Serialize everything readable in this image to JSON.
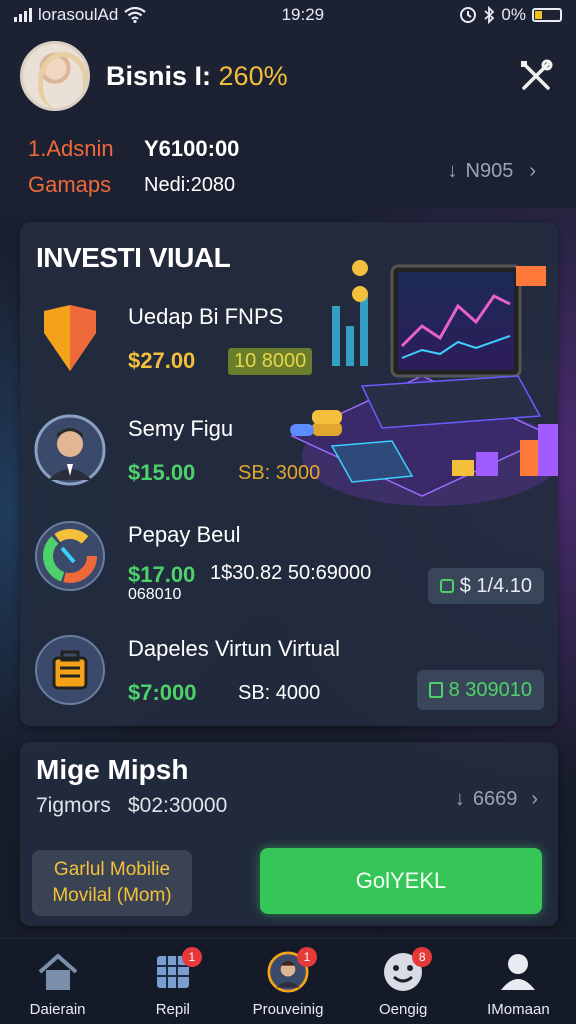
{
  "status_bar": {
    "carrier": "lorasoulAd",
    "time": "19:29",
    "battery": "0%"
  },
  "header": {
    "title": "Bisnis I: ",
    "percent": "260%"
  },
  "summary": {
    "row1_label": "1.Adsnin",
    "row1_value": "Y6100:00",
    "row2_label": "Gamaps",
    "row2_value": "Nedi:2080",
    "right_value": "N905"
  },
  "invest_card": {
    "title": "INVESTI VIUAL",
    "items": [
      {
        "name": "Uedap Bi FNPS",
        "price": "$27.00",
        "meta": "10 8000",
        "meta_color": "#e8d64a"
      },
      {
        "name": "Semy Figu",
        "price": "$15.00",
        "meta": "SB: 3000",
        "meta_color": "#e0a62e"
      },
      {
        "name": "Pepay Beul",
        "price": "$17.00",
        "meta": "1$30.82 50:69000",
        "meta2": "068010",
        "pill": "$ 1/4.10",
        "meta_color": "#e8ecf2"
      },
      {
        "name": "Dapeles Virtun Virtual",
        "price": "$7:000",
        "meta": "SB: 4000",
        "pill": "8 309010",
        "meta_color": "#e8ecf2"
      }
    ]
  },
  "bottom_card": {
    "title": "Mige Mipsh",
    "sub_label": "7igmors",
    "sub_value": "$02:30000",
    "right_value": "6669",
    "promo_line1": "Garlul Mobilie",
    "promo_line2": "Movilal (Mom)",
    "cta_label": "GolYEKL"
  },
  "nav": [
    {
      "label": "Daierain",
      "icon": "home-icon"
    },
    {
      "label": "Repil",
      "icon": "calendar-icon",
      "badge": "1"
    },
    {
      "label": "Prouveinig",
      "icon": "profile-icon",
      "badge": "1"
    },
    {
      "label": "Oengig",
      "icon": "smiley-icon",
      "badge": "8"
    },
    {
      "label": "IMomaan",
      "icon": "user-icon"
    }
  ],
  "colors": {
    "accent_orange": "#ef6a3a",
    "accent_yellow": "#f4c03b",
    "accent_green": "#35c657"
  }
}
